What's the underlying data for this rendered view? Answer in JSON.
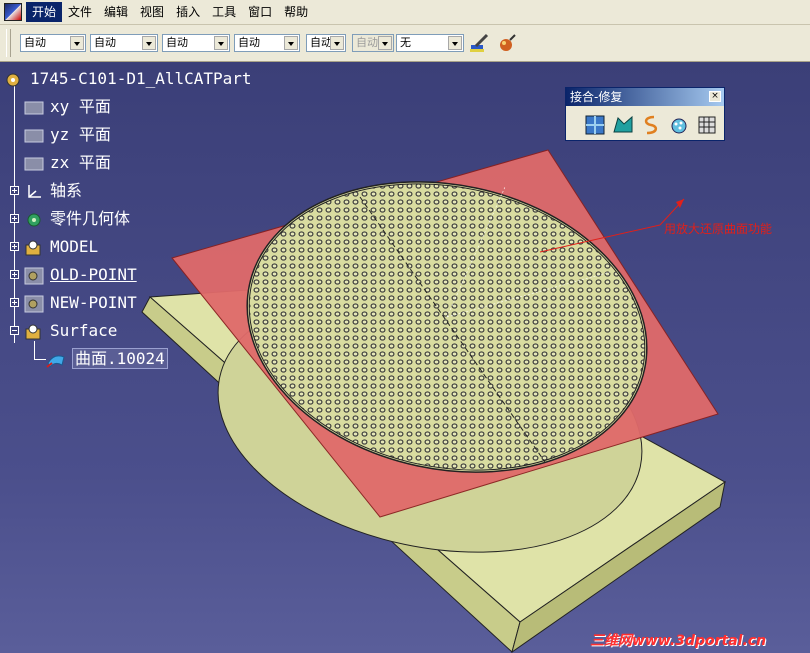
{
  "menu": {
    "items": [
      "开始",
      "文件",
      "编辑",
      "视图",
      "插入",
      "工具",
      "窗口",
      "帮助"
    ]
  },
  "toolbar": {
    "combos": [
      {
        "value": "自动",
        "disabled": false
      },
      {
        "value": "自动",
        "disabled": false
      },
      {
        "value": "自动",
        "disabled": false
      },
      {
        "value": "自动",
        "disabled": false
      },
      {
        "value": "自动",
        "disabled": false
      },
      {
        "value": "自动",
        "disabled": true
      },
      {
        "value": "无",
        "disabled": false
      }
    ],
    "icons": [
      "paint-brush-icon",
      "apply-material-icon"
    ]
  },
  "tree": {
    "root": "1745-C101-D1_AllCATPart",
    "items": [
      {
        "label": "xy 平面",
        "icon": "plane-icon"
      },
      {
        "label": "yz 平面",
        "icon": "plane-icon"
      },
      {
        "label": "zx 平面",
        "icon": "plane-icon"
      },
      {
        "label": "轴系",
        "icon": "axis-system-icon"
      },
      {
        "label": "零件几何体",
        "icon": "part-body-icon"
      },
      {
        "label": "MODEL",
        "icon": "geometrical-set-icon"
      },
      {
        "label": "OLD-POINT",
        "icon": "geometrical-set-hidden-icon"
      },
      {
        "label": "NEW-POINT",
        "icon": "geometrical-set-hidden-icon"
      },
      {
        "label": "Surface",
        "icon": "geometrical-set-icon"
      },
      {
        "label": "曲面.10024",
        "icon": "surface-icon"
      }
    ]
  },
  "float_toolbar": {
    "title": "接合-修复",
    "close": "×",
    "icons": [
      "join-icon",
      "healing-icon",
      "curve-smooth-icon",
      "untrim-icon",
      "disassemble-icon"
    ]
  },
  "annotation": "用放大还原曲面功能",
  "watermark": "三维网www.3dportal.cn",
  "colors": {
    "background": "#3b3f78",
    "plate": "#dfe3a8",
    "surface": "#e06a6a",
    "annotation": "#e0201a"
  }
}
